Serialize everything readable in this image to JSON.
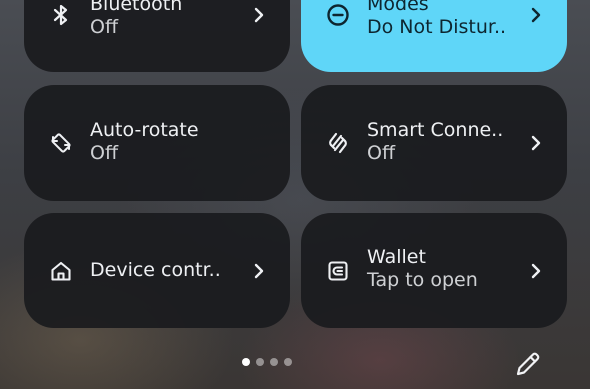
{
  "tiles": {
    "bluetooth": {
      "title": "Bluetooth",
      "subtitle": "Off",
      "icon": "bluetooth-icon"
    },
    "modes": {
      "title": "Modes",
      "subtitle": "Do Not Distur..",
      "icon": "do-not-disturb-icon",
      "accent": "#5fd6f8"
    },
    "auto_rotate": {
      "title": "Auto-rotate",
      "subtitle": "Off",
      "icon": "rotate-icon"
    },
    "smart_connect": {
      "title": "Smart Conne..",
      "subtitle": "Off",
      "icon": "smart-connect-icon"
    },
    "device_controls": {
      "title": "Device contr..",
      "icon": "home-icon"
    },
    "wallet": {
      "title": "Wallet",
      "subtitle": "Tap to open",
      "icon": "wallet-icon"
    }
  },
  "pager": {
    "pages": 4,
    "current": 1
  },
  "edit": {
    "icon": "pencil-icon"
  }
}
